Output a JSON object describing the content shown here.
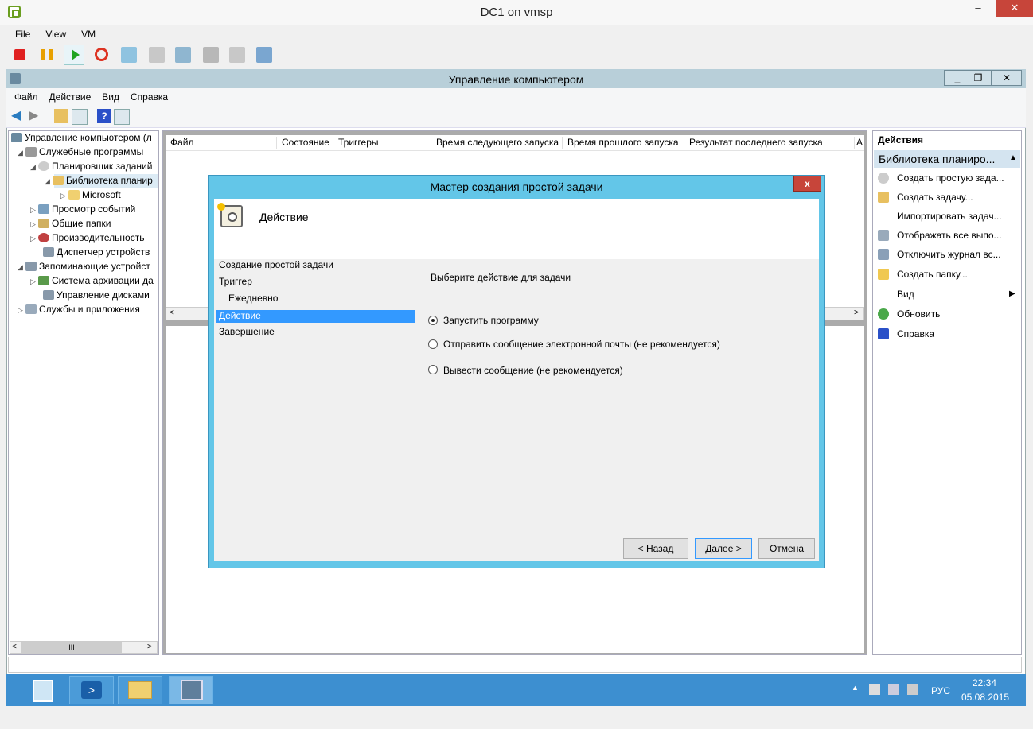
{
  "vm": {
    "title": "DC1 on vmsp",
    "menu": [
      "File",
      "View",
      "VM"
    ]
  },
  "mmc": {
    "title": "Управление компьютером",
    "menu": [
      "Файл",
      "Действие",
      "Вид",
      "Справка"
    ],
    "tree": [
      {
        "label": "Управление компьютером (л",
        "icon": "computer-management-icon"
      },
      {
        "label": "Служебные программы",
        "icon": "tools-icon"
      },
      {
        "label": "Планировщик заданий",
        "icon": "clock-icon"
      },
      {
        "label": "Библиотека планир",
        "icon": "folder-clock-icon"
      },
      {
        "label": "Microsoft",
        "icon": "folder-icon"
      },
      {
        "label": "Просмотр событий",
        "icon": "event-viewer-icon"
      },
      {
        "label": "Общие папки",
        "icon": "shared-folders-icon"
      },
      {
        "label": "Производительность",
        "icon": "performance-icon"
      },
      {
        "label": "Диспетчер устройств",
        "icon": "device-manager-icon"
      },
      {
        "label": "Запоминающие устройст",
        "icon": "storage-icon"
      },
      {
        "label": "Система архивации да",
        "icon": "backup-icon"
      },
      {
        "label": "Управление дисками",
        "icon": "disk-icon"
      },
      {
        "label": "Службы и приложения",
        "icon": "services-icon"
      }
    ],
    "columns": [
      "Файл",
      "Состояние",
      "Триггеры",
      "Время следующего запуска",
      "Время прошлого запуска",
      "Результат последнего запуска",
      "А"
    ],
    "actions_header": "Действия",
    "actions_sub": "Библиотека планиро...",
    "actions": [
      "Создать простую зада...",
      "Создать задачу...",
      "Импортировать задач...",
      "Отображать все выпо...",
      "Отключить журнал вс...",
      "Создать папку...",
      "Вид",
      "Обновить",
      "Справка"
    ],
    "scroll_thumb": "III"
  },
  "wizard": {
    "title": "Мастер создания простой задачи",
    "close": "x",
    "header_title": "Действие",
    "steps": [
      "Создание простой задачи",
      "Триггер",
      "Ежедневно",
      "Действие",
      "Завершение"
    ],
    "prompt": "Выберите действие для задачи",
    "options": [
      "Запустить программу",
      "Отправить сообщение электронной почты (не рекомендуется)",
      "Вывести сообщение (не рекомендуется)"
    ],
    "selected_option": "Запустить программу",
    "buttons": {
      "back": "< Назад",
      "next": "Далее >",
      "cancel": "Отмена"
    }
  },
  "tray": {
    "lang": "РУС",
    "time": "22:34",
    "date": "05.08.2015"
  },
  "colors": {
    "wizard_frame": "#63c6e8",
    "taskbar": "#3d8fd0",
    "selection": "#3399ff",
    "close_red": "#c7453a"
  }
}
